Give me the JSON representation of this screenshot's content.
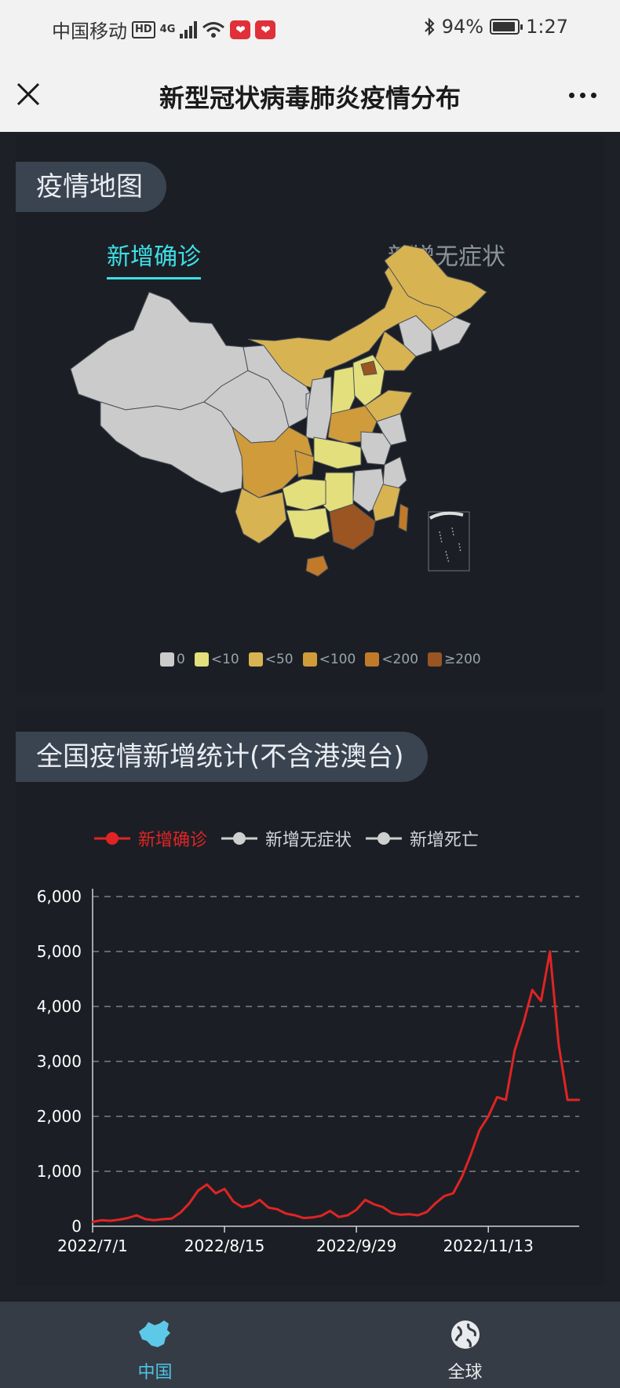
{
  "status": {
    "carrier": "中国移动",
    "hd": "HD",
    "network": "4G",
    "battery": "94%",
    "time": "1:27",
    "gift_icon": "red-gift-icon"
  },
  "header": {
    "title": "新型冠状病毒肺炎疫情分布"
  },
  "map_card": {
    "title": "疫情地图",
    "tabs": [
      {
        "label": "新增确诊",
        "active": true
      },
      {
        "label": "新增无症状",
        "active": false
      }
    ],
    "legend": [
      {
        "label": "0",
        "color": "#cbcbcb"
      },
      {
        "label": "<10",
        "color": "#e3df7c"
      },
      {
        "label": "<50",
        "color": "#d8b352"
      },
      {
        "label": "<100",
        "color": "#cf9b3b"
      },
      {
        "label": "<200",
        "color": "#c17a2a"
      },
      {
        "label": "≥200",
        "color": "#9a5522"
      }
    ]
  },
  "chart_card": {
    "title": "全国疫情新增统计(不含港澳台)",
    "legend": [
      {
        "name": "新增确诊",
        "color": "#e02424",
        "active": true
      },
      {
        "name": "新增无症状",
        "color": "#cfcfcf",
        "active": false
      },
      {
        "name": "新增死亡",
        "color": "#cfcfcf",
        "active": false
      }
    ]
  },
  "chart_data": {
    "type": "line",
    "title": "全国疫情新增统计(不含港澳台)",
    "xlabel": "",
    "ylabel": "",
    "x_range": [
      "2022/7/1",
      "2022/12/14"
    ],
    "xticks": [
      "2022/7/1",
      "2022/8/15",
      "2022/9/29",
      "2022/11/13"
    ],
    "ylim": [
      0,
      6000
    ],
    "yticks": [
      "0",
      "1,000",
      "2,000",
      "3,000",
      "4,000",
      "5,000",
      "6,000"
    ],
    "grid": true,
    "legend_position": "top",
    "series": [
      {
        "name": "新增确诊",
        "color": "#e02424",
        "x": [
          "2022/7/1",
          "2022/7/4",
          "2022/7/7",
          "2022/7/10",
          "2022/7/13",
          "2022/7/16",
          "2022/7/19",
          "2022/7/22",
          "2022/7/25",
          "2022/7/28",
          "2022/7/31",
          "2022/8/3",
          "2022/8/6",
          "2022/8/9",
          "2022/8/12",
          "2022/8/15",
          "2022/8/18",
          "2022/8/21",
          "2022/8/24",
          "2022/8/27",
          "2022/8/30",
          "2022/9/2",
          "2022/9/5",
          "2022/9/8",
          "2022/9/11",
          "2022/9/14",
          "2022/9/17",
          "2022/9/20",
          "2022/9/23",
          "2022/9/26",
          "2022/9/29",
          "2022/10/2",
          "2022/10/5",
          "2022/10/8",
          "2022/10/11",
          "2022/10/14",
          "2022/10/17",
          "2022/10/20",
          "2022/10/23",
          "2022/10/26",
          "2022/10/29",
          "2022/11/1",
          "2022/11/4",
          "2022/11/7",
          "2022/11/10",
          "2022/11/13",
          "2022/11/16",
          "2022/11/19",
          "2022/11/22",
          "2022/11/25",
          "2022/11/28",
          "2022/12/1",
          "2022/12/4",
          "2022/12/7",
          "2022/12/10",
          "2022/12/14"
        ],
        "values": [
          80,
          110,
          100,
          120,
          150,
          200,
          130,
          110,
          130,
          140,
          250,
          420,
          650,
          760,
          600,
          680,
          450,
          350,
          380,
          480,
          340,
          310,
          230,
          200,
          150,
          160,
          190,
          280,
          170,
          200,
          300,
          480,
          400,
          350,
          240,
          210,
          220,
          200,
          260,
          420,
          550,
          600,
          900,
          1300,
          1750,
          2000,
          2350,
          2300,
          3200,
          3700,
          4300,
          4100,
          5000,
          3300,
          2300,
          2300
        ]
      }
    ]
  },
  "nav": {
    "items": [
      {
        "label": "中国",
        "icon": "china-map-icon",
        "active": true
      },
      {
        "label": "全球",
        "icon": "globe-icon",
        "active": false
      }
    ]
  }
}
